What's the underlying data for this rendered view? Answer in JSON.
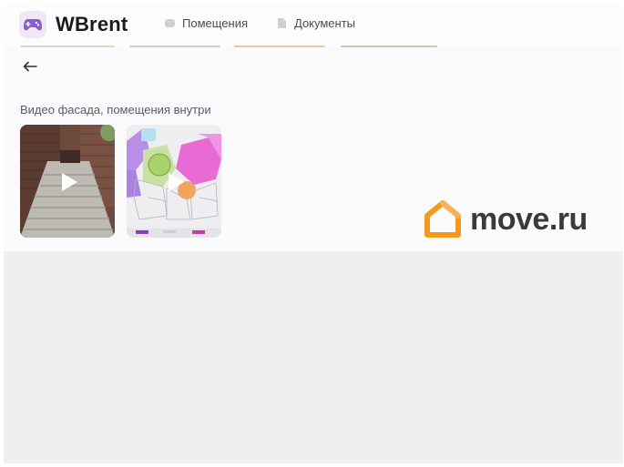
{
  "header": {
    "brand": "WBrent",
    "nav": [
      {
        "label": "Помещения",
        "icon": "rooms-icon"
      },
      {
        "label": "Документы",
        "icon": "document-icon"
      }
    ]
  },
  "media": {
    "section_title": "Видео фасада, помещения внутри",
    "items": [
      {
        "name": "facade-video",
        "kind": "video"
      },
      {
        "name": "floorplan-video",
        "kind": "video"
      }
    ]
  },
  "watermark": {
    "text": "move.ru"
  },
  "colors": {
    "accent": "#8a5cd8",
    "watermark_orange": "#f39a1e",
    "watermark_text": "#3a3a3a"
  }
}
